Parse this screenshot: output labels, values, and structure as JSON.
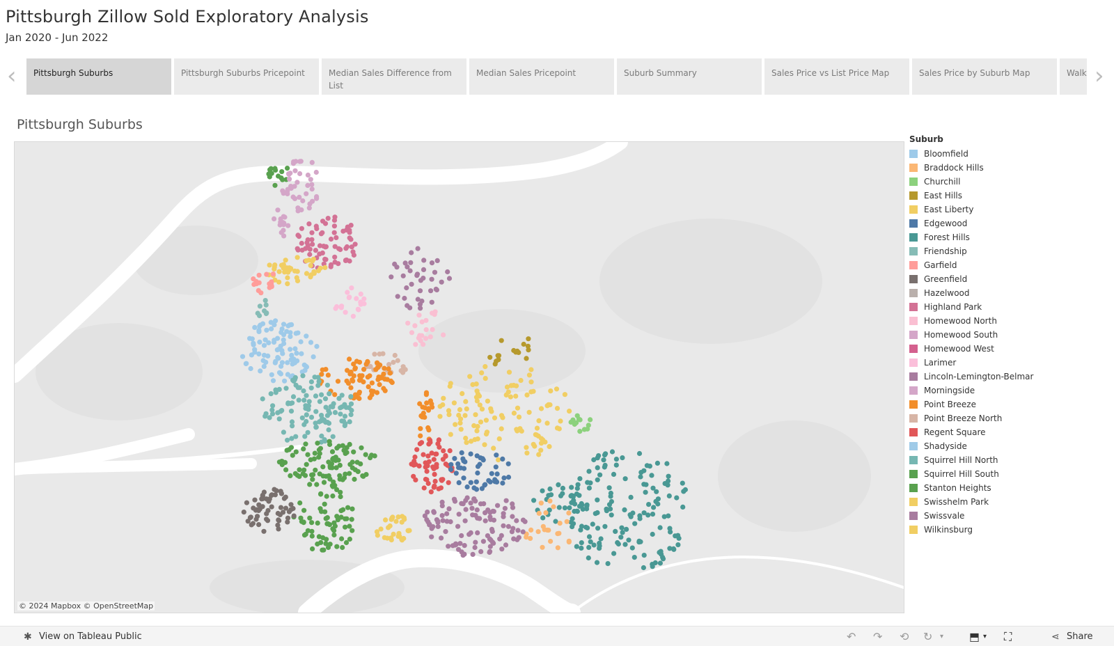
{
  "dashboard": {
    "title": "Pittsburgh Zillow Sold Exploratory Analysis",
    "subtitle": "Jan 2020 - Jun 2022"
  },
  "tabs": [
    {
      "label": "Pittsburgh Suburbs",
      "active": true
    },
    {
      "label": "Pittsburgh Suburbs Pricepoint",
      "active": false
    },
    {
      "label": "Median Sales Difference from List",
      "active": false
    },
    {
      "label": "Median Sales Pricepoint",
      "active": false
    },
    {
      "label": "Suburb Summary",
      "active": false
    },
    {
      "label": "Sales Price vs List Price Map",
      "active": false
    },
    {
      "label": "Sales Price by Suburb Map",
      "active": false
    },
    {
      "label": "Walk",
      "active": false
    }
  ],
  "sheet": {
    "title": "Pittsburgh Suburbs",
    "attribution": "© 2024 Mapbox  © OpenStreetMap"
  },
  "legend": {
    "title": "Suburb",
    "items": [
      {
        "label": "Bloomfield",
        "color": "#9ecae9"
      },
      {
        "label": "Braddock Hills",
        "color": "#fbb774"
      },
      {
        "label": "Churchill",
        "color": "#8cd17d"
      },
      {
        "label": "East Hills",
        "color": "#b6992d"
      },
      {
        "label": "East Liberty",
        "color": "#f1ce63"
      },
      {
        "label": "Edgewood",
        "color": "#4e79a7"
      },
      {
        "label": "Forest Hills",
        "color": "#499894"
      },
      {
        "label": "Friendship",
        "color": "#86bcb6"
      },
      {
        "label": "Garfield",
        "color": "#ff9d9a"
      },
      {
        "label": "Greenfield",
        "color": "#79706e"
      },
      {
        "label": "Hazelwood",
        "color": "#bab0ac"
      },
      {
        "label": "Highland Park",
        "color": "#d37295"
      },
      {
        "label": "Homewood North",
        "color": "#fabfd2"
      },
      {
        "label": "Homewood South",
        "color": "#d4a6c8"
      },
      {
        "label": "Homewood West",
        "color": "#d4608e"
      },
      {
        "label": "Larimer",
        "color": "#fbbfda"
      },
      {
        "label": "Lincoln-Lemington-Belmar",
        "color": "#a87c9f"
      },
      {
        "label": "Morningside",
        "color": "#d4a6c8"
      },
      {
        "label": "Point Breeze",
        "color": "#f28e2b"
      },
      {
        "label": "Point Breeze North",
        "color": "#d7b5a6"
      },
      {
        "label": "Regent Square",
        "color": "#e15759"
      },
      {
        "label": "Shadyside",
        "color": "#a0cbe8"
      },
      {
        "label": "Squirrel Hill North",
        "color": "#76b7b2"
      },
      {
        "label": "Squirrel Hill South",
        "color": "#59a14f"
      },
      {
        "label": "Stanton Heights",
        "color": "#59a14f"
      },
      {
        "label": "Swisshelm Park",
        "color": "#f1ce63"
      },
      {
        "label": "Swissvale",
        "color": "#a87c9f"
      },
      {
        "label": "Wilkinsburg",
        "color": "#f1ce63"
      }
    ]
  },
  "footer": {
    "view_link": "View on Tableau Public",
    "share": "Share"
  }
}
